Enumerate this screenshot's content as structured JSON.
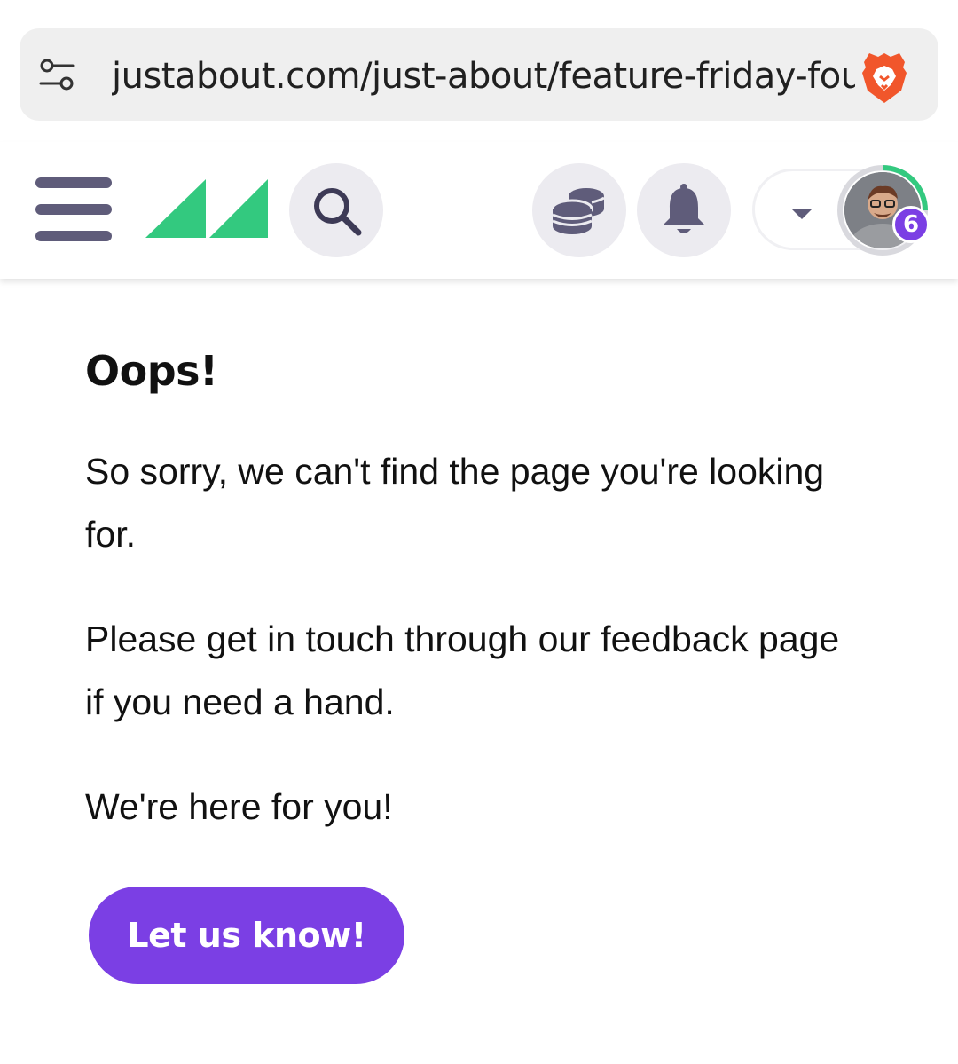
{
  "browser": {
    "url": "justabout.com/just-about/feature-friday-foun",
    "settings_icon": "tune-icon",
    "brave_icon": "brave-lion-icon"
  },
  "header": {
    "menu_icon": "hamburger-icon",
    "logo": "justabout-logo",
    "search_icon": "search-icon",
    "coins_icon": "coins-icon",
    "bell_icon": "bell-icon",
    "caret_icon": "caret-down-icon",
    "avatar_badge": "6",
    "colors": {
      "accent": "#7b3fe4",
      "logo_green": "#33c97f",
      "icon_gray": "#5f5c7a"
    }
  },
  "content": {
    "title": "Oops!",
    "paragraph1": "So sorry, we can't find the page you're looking for.",
    "paragraph2": "Please get in touch through our feedback page if you need a hand.",
    "paragraph3": "We're here for you!",
    "cta_label": "Let us know!"
  }
}
